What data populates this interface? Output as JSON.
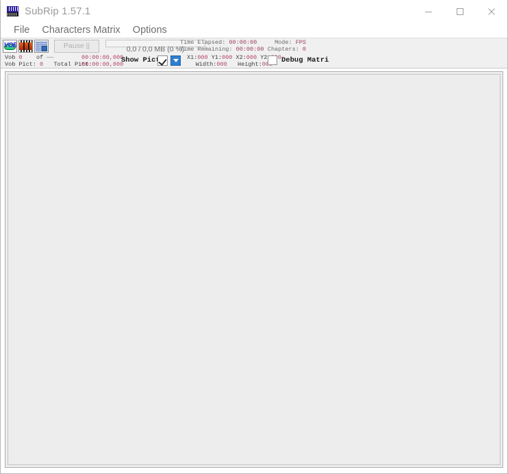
{
  "window": {
    "title": "SubRip 1.57.1",
    "icon": "subrip-app-icon",
    "minimize_label": "—",
    "maximize_label": "□",
    "close_label": "✕"
  },
  "menubar": {
    "items": [
      {
        "label": "File",
        "name": "menu-file"
      },
      {
        "label": "Characters Matrix",
        "name": "menu-characters-matrix"
      },
      {
        "label": "Options",
        "name": "menu-options"
      }
    ]
  },
  "toolbar": {
    "icons": [
      {
        "name": "open-vob-icon",
        "label": "VOB"
      },
      {
        "name": "open-filmstrip-icon",
        "label": ""
      },
      {
        "name": "matrix-dither-icon",
        "label": ""
      }
    ],
    "pause_button": "Pause ||",
    "progress": {
      "text": "0,0 / 0,0 MB (0 %)",
      "percent": 0
    },
    "time_elapsed_label": "Time Elapsed:",
    "time_elapsed_value": "00:00:00",
    "time_remaining_label": "Time Remaining:",
    "time_remaining_value": "00:00:00",
    "mode_label": "Mode:",
    "mode_value": "FPS",
    "chapters_label": "Chapters:",
    "chapters_value": "0"
  },
  "status": {
    "vob_label": "Vob",
    "vob_value": "0",
    "vob_of_label": "of",
    "vob_of_value": "——",
    "vob_pict_label": "Vob Pict:",
    "vob_pict_value": "0",
    "total_pict_label": "Total Pict:",
    "total_pict_value": "",
    "time_top": "00:00:00,000",
    "time_bottom": "00:00:00,000",
    "show_pict_label": "Show Pict.",
    "show_pict_checked": true,
    "dropdown_caret": "▼",
    "coord_x1_label": "X1:",
    "coord_x1_value": "000",
    "coord_y1_label": "Y1:",
    "coord_y1_value": "000",
    "coord_x2_label": "X2:",
    "coord_x2_value": "000",
    "coord_y2_label": "Y2:",
    "coord_y2_value": "000",
    "width_label": "Width:",
    "width_value": "000",
    "height_label": "Height:",
    "height_value": "000",
    "debug_matrix_label": "Debug Matri",
    "debug_matrix_checked": false
  },
  "canvas": {
    "content": ""
  },
  "colors": {
    "accent_blue": "#2e7fd0",
    "magenta_value": "#b0406a",
    "panel_bg": "#f0f0f0",
    "canvas_bg": "#ededed"
  }
}
